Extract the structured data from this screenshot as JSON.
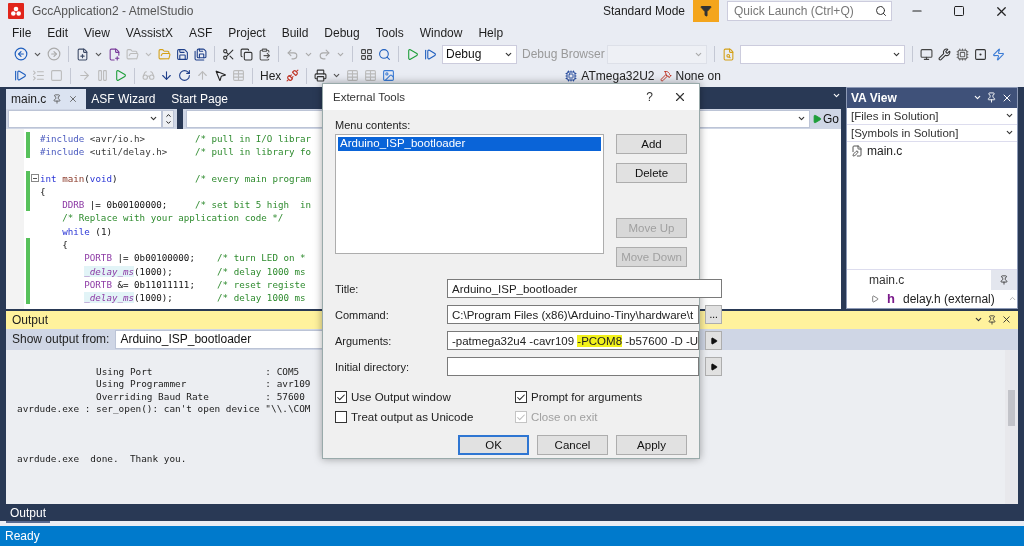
{
  "window": {
    "title": "GccApplication2 - AtmelStudio"
  },
  "title_bar": {
    "mode": "Standard Mode",
    "quick_launch": {
      "placeholder": "Quick Launch (Ctrl+Q)"
    }
  },
  "menu": [
    "File",
    "Edit",
    "View",
    "VAssistX",
    "ASF",
    "Project",
    "Build",
    "Debug",
    "Tools",
    "Window",
    "Help"
  ],
  "toolbar": {
    "configuration": "Debug",
    "debug_browser": "Debug Browser",
    "hex": "Hex",
    "device": "ATmega32U2",
    "tool": "None on"
  },
  "editor_tabs": [
    {
      "label": "main.c",
      "selected": true
    },
    {
      "label": "ASF Wizard",
      "selected": false
    },
    {
      "label": "Start Page",
      "selected": false
    }
  ],
  "go_button": "Go",
  "code_lines": [
    {
      "changed": true,
      "tokens": [
        {
          "kind": "directive",
          "text": "#include"
        },
        {
          "kind": "header",
          "text": " <avr/io.h>"
        },
        {
          "kind": "comment",
          "text": "         /* pull in I/O librar"
        }
      ]
    },
    {
      "changed": true,
      "tokens": [
        {
          "kind": "directive",
          "text": "#include"
        },
        {
          "kind": "header",
          "text": " <util/delay.h>"
        },
        {
          "kind": "comment",
          "text": "     /* pull in library fo"
        }
      ]
    },
    {
      "changed": false
    },
    {
      "changed": true,
      "collapsible": true,
      "tokens": [
        {
          "kind": "keyword",
          "text": "int"
        },
        {
          "kind": "function",
          "text": " main"
        },
        {
          "kind": "plain",
          "text": "("
        },
        {
          "kind": "keyword",
          "text": "void"
        },
        {
          "kind": "plain",
          "text": ")"
        },
        {
          "kind": "comment",
          "text": "              /* every main program"
        }
      ]
    },
    {
      "changed": true,
      "tokens": [
        {
          "kind": "plain",
          "text": "{"
        }
      ]
    },
    {
      "changed": true,
      "tokens": [
        {
          "kind": "macro",
          "text": "    DDRB"
        },
        {
          "kind": "plain",
          "text": " |= 0b00100000;"
        },
        {
          "kind": "comment",
          "text": "     /* set bit 5 high  in"
        }
      ]
    },
    {
      "changed": false,
      "tokens": [
        {
          "kind": "comment",
          "text": "    /* Replace with your application code */"
        }
      ]
    },
    {
      "changed": false,
      "tokens": [
        {
          "kind": "keyword",
          "text": "    while"
        },
        {
          "kind": "plain",
          "text": " (1)"
        }
      ]
    },
    {
      "changed": true,
      "tokens": [
        {
          "kind": "plain",
          "text": "    {"
        }
      ]
    },
    {
      "changed": true,
      "tokens": [
        {
          "kind": "macro",
          "text": "        PORTB"
        },
        {
          "kind": "plain",
          "text": " |= 0b00100000;"
        },
        {
          "kind": "comment",
          "text": "    /* turn LED on *"
        }
      ]
    },
    {
      "changed": true,
      "tokens": [
        {
          "kind": "call",
          "text": "        _delay_ms"
        },
        {
          "kind": "plain",
          "text": "(1000);"
        },
        {
          "kind": "comment",
          "text": "        /* delay 1000 ms"
        }
      ]
    },
    {
      "changed": true,
      "tokens": [
        {
          "kind": "macro",
          "text": "        PORTB"
        },
        {
          "kind": "plain",
          "text": " &= 0b11011111;"
        },
        {
          "kind": "comment",
          "text": "    /* reset registe"
        }
      ]
    },
    {
      "changed": true,
      "tokens": [
        {
          "kind": "call",
          "text": "        _delay_ms"
        },
        {
          "kind": "plain",
          "text": "(1000);"
        },
        {
          "kind": "comment",
          "text": "        /* delay 1000 ms"
        }
      ]
    }
  ],
  "va_view": {
    "title": "VA View",
    "files_dropdown": "[Files in Solution]",
    "symbols_dropdown": "[Symbols in Solution]",
    "files": [
      "main.c"
    ],
    "context_tab": "main.c",
    "tree": [
      {
        "glyph": "h",
        "label": "delay.h (external)",
        "expanded": false
      }
    ]
  },
  "output": {
    "title": "Output",
    "source_label": "Show output from:",
    "source": "Arduino_ISP_bootloader",
    "lines": [
      "              Using Port                    : COM5",
      "              Using Programmer              : avr109",
      "              Overriding Baud Rate          : 57600",
      "avrdude.exe : ser_open(): can't open device \"\\\\.\\COM"
    ],
    "summary": "avrdude.exe  done.  Thank you."
  },
  "bottom_tabs": [
    {
      "label": "Output",
      "selected": true
    }
  ],
  "status_bar": "Ready",
  "dialog": {
    "title": "External Tools",
    "help": "?",
    "menu_contents_label": "Menu contents:",
    "menu_items": [
      {
        "label": "Arduino_ISP_bootloader",
        "selected": true
      }
    ],
    "side_buttons": [
      {
        "label": "Add",
        "disabled": false
      },
      {
        "label": "Delete",
        "disabled": false
      },
      {
        "label": "Move Up",
        "disabled": true
      },
      {
        "label": "Move Down",
        "disabled": true
      }
    ],
    "fields": [
      {
        "kind": "plain",
        "label": "Title:",
        "parts": [
          {
            "text": "Arduino_ISP_bootloader",
            "highlighted": false
          }
        ]
      },
      {
        "kind": "browse",
        "label": "Command:",
        "button": "...",
        "parts": [
          {
            "text": "C:\\Program Files (x86)\\Arduino-Tiny\\hardware\\t",
            "highlighted": false
          }
        ]
      },
      {
        "kind": "arrow",
        "label": "Arguments:",
        "parts": [
          {
            "text": "-patmega32u4 -cavr109 ",
            "highlighted": false
          },
          {
            "text": "-PCOM8",
            "highlighted": true
          },
          {
            "text": " -b57600 -D -U",
            "highlighted": false
          }
        ]
      },
      {
        "kind": "arrow",
        "label": "Initial directory:"
      }
    ],
    "checkboxes": [
      {
        "label": "Use Output window",
        "checked": true,
        "disabled": false
      },
      {
        "label": "Prompt for arguments",
        "checked": true,
        "disabled": false
      },
      {
        "label": "Treat output as Unicode",
        "checked": false,
        "disabled": false
      },
      {
        "label": "Close on exit",
        "checked": true,
        "disabled": true
      }
    ],
    "buttons": [
      {
        "label": "OK",
        "default": true
      },
      {
        "label": "Cancel",
        "default": false
      },
      {
        "label": "Apply",
        "default": false
      }
    ]
  }
}
